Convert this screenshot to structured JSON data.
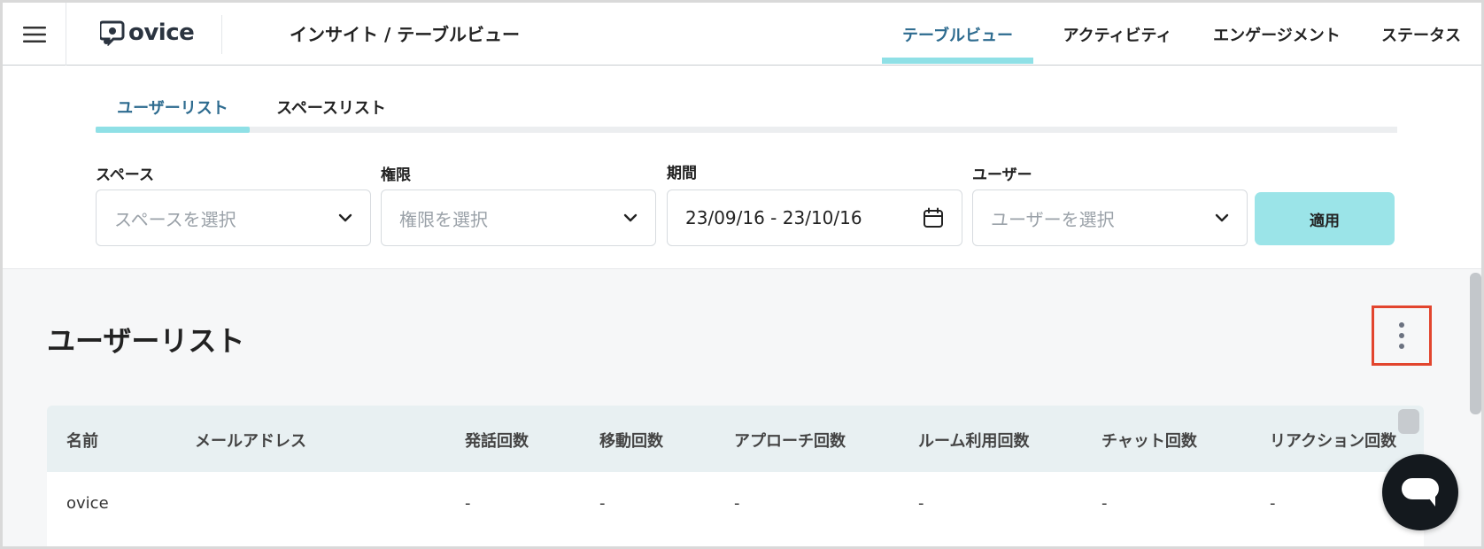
{
  "header": {
    "logo_text": "ovice",
    "page_title": "インサイト / テーブルビュー",
    "tabs": [
      {
        "label": "テーブルビュー",
        "active": true
      },
      {
        "label": "アクティビティ",
        "active": false
      },
      {
        "label": "エンゲージメント",
        "active": false
      },
      {
        "label": "ステータス",
        "active": false
      }
    ]
  },
  "subtabs": [
    {
      "label": "ユーザーリスト",
      "active": true
    },
    {
      "label": "スペースリスト",
      "active": false
    }
  ],
  "filters": {
    "space": {
      "label": "スペース",
      "placeholder": "スペースを選択"
    },
    "permission": {
      "label": "権限",
      "placeholder": "権限を選択"
    },
    "period": {
      "label": "期間",
      "value": "23/09/16 - 23/10/16"
    },
    "user": {
      "label": "ユーザー",
      "placeholder": "ユーザーを選択"
    },
    "apply_label": "適用"
  },
  "list": {
    "title": "ユーザーリスト",
    "columns": [
      "名前",
      "メールアドレス",
      "発話回数",
      "移動回数",
      "アプローチ回数",
      "ルーム利用回数",
      "チャット回数",
      "リアクション回数"
    ],
    "rows": [
      [
        "ovice",
        "",
        "-",
        "-",
        "-",
        "-",
        "-",
        "-"
      ]
    ]
  },
  "icons": {
    "menu": "hamburger-menu-icon",
    "chevron": "chevron-down-icon",
    "calendar": "calendar-icon",
    "more": "vertical-dots-icon",
    "chat": "chat-bubble-icon"
  },
  "colors": {
    "accent": "#8fe0e6",
    "active_text": "#2d6b8f",
    "apply_button": "#9be4e8",
    "highlight_box": "#e2452e"
  }
}
